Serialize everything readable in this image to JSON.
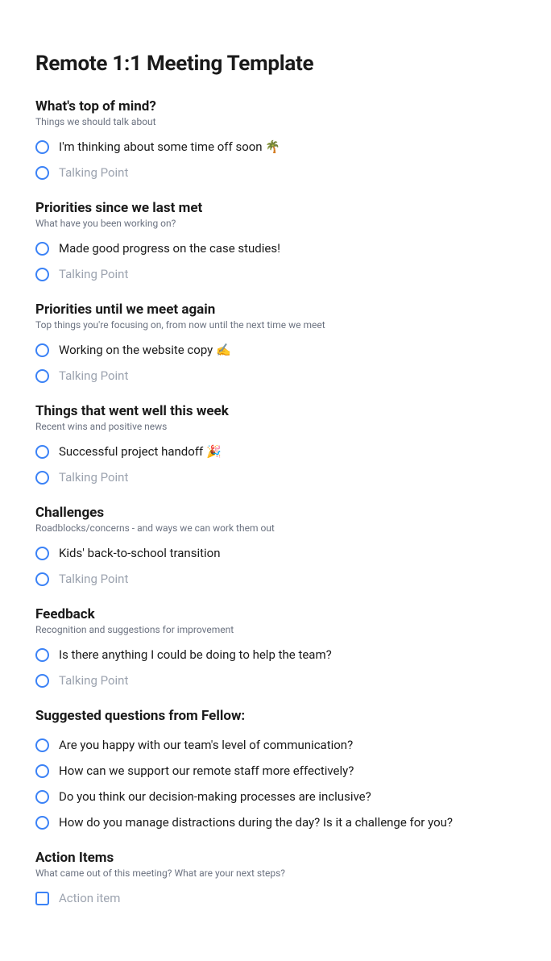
{
  "title": "Remote 1:1 Meeting Template",
  "sections": [
    {
      "title": "What's top of mind?",
      "subtitle": "Things we should talk about",
      "items": [
        {
          "text": "I'm thinking about some time off soon 🌴",
          "placeholder": false
        },
        {
          "text": "Talking Point",
          "placeholder": true
        }
      ],
      "type": "radio"
    },
    {
      "title": "Priorities since we last met",
      "subtitle": "What have you been working on?",
      "items": [
        {
          "text": "Made good progress on the case studies!",
          "placeholder": false
        },
        {
          "text": "Talking Point",
          "placeholder": true
        }
      ],
      "type": "radio"
    },
    {
      "title": "Priorities until we meet again",
      "subtitle": "Top things you're focusing on, from now until the next time we meet",
      "items": [
        {
          "text": "Working on the website copy ✍️",
          "placeholder": false
        },
        {
          "text": "Talking Point",
          "placeholder": true
        }
      ],
      "type": "radio"
    },
    {
      "title": "Things that went well this week",
      "subtitle": "Recent wins and positive news",
      "items": [
        {
          "text": "Successful project handoff 🎉",
          "placeholder": false
        },
        {
          "text": "Talking Point",
          "placeholder": true
        }
      ],
      "type": "radio"
    },
    {
      "title": "Challenges",
      "subtitle": "Roadblocks/concerns - and ways we can work them out",
      "items": [
        {
          "text": "Kids' back-to-school transition",
          "placeholder": false
        },
        {
          "text": "Talking Point",
          "placeholder": true
        }
      ],
      "type": "radio"
    },
    {
      "title": "Feedback",
      "subtitle": "Recognition and suggestions for improvement",
      "items": [
        {
          "text": "Is there anything I could be doing to help the team?",
          "placeholder": false
        },
        {
          "text": "Talking Point",
          "placeholder": true
        }
      ],
      "type": "radio"
    },
    {
      "title": "Suggested questions from Fellow:",
      "subtitle": "",
      "items": [
        {
          "text": "Are you happy with our team's level of communication?",
          "placeholder": false
        },
        {
          "text": "How can we support our remote staff more effectively?",
          "placeholder": false
        },
        {
          "text": "Do you think our decision-making processes are inclusive?",
          "placeholder": false
        },
        {
          "text": "How do you manage distractions during the day? Is it a challenge for you?",
          "placeholder": false
        }
      ],
      "type": "radio"
    },
    {
      "title": "Action Items",
      "subtitle": "What came out of this meeting? What are your next steps?",
      "items": [
        {
          "text": "Action item",
          "placeholder": true
        }
      ],
      "type": "checkbox"
    }
  ]
}
